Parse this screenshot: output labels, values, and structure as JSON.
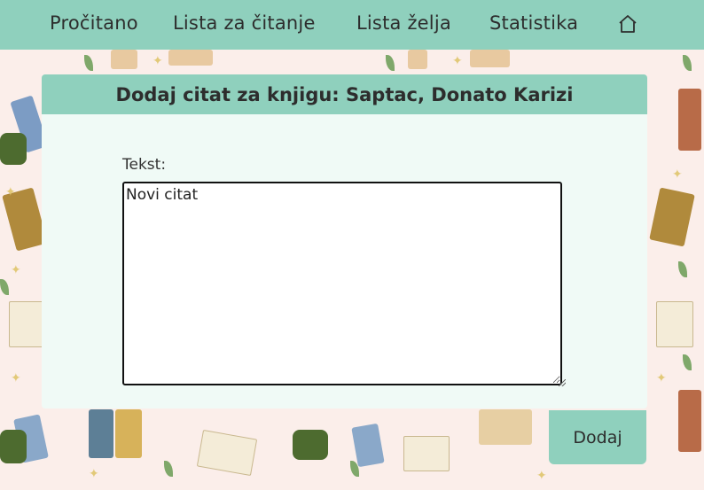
{
  "nav": {
    "items": [
      {
        "label": "Pročitano"
      },
      {
        "label": "Lista za čitanje"
      },
      {
        "label": "Lista želja"
      },
      {
        "label": "Statistika"
      }
    ],
    "home_icon": "home-icon"
  },
  "form": {
    "title": "Dodaj citat za knjigu: Saptac, Donato Karizi",
    "text_label": "Tekst:",
    "text_value": "Novi citat ",
    "submit_label": "Dodaj"
  },
  "colors": {
    "accent": "#8fd0bd",
    "card_bg": "#f0faf6",
    "page_bg": "#fbeeea"
  }
}
